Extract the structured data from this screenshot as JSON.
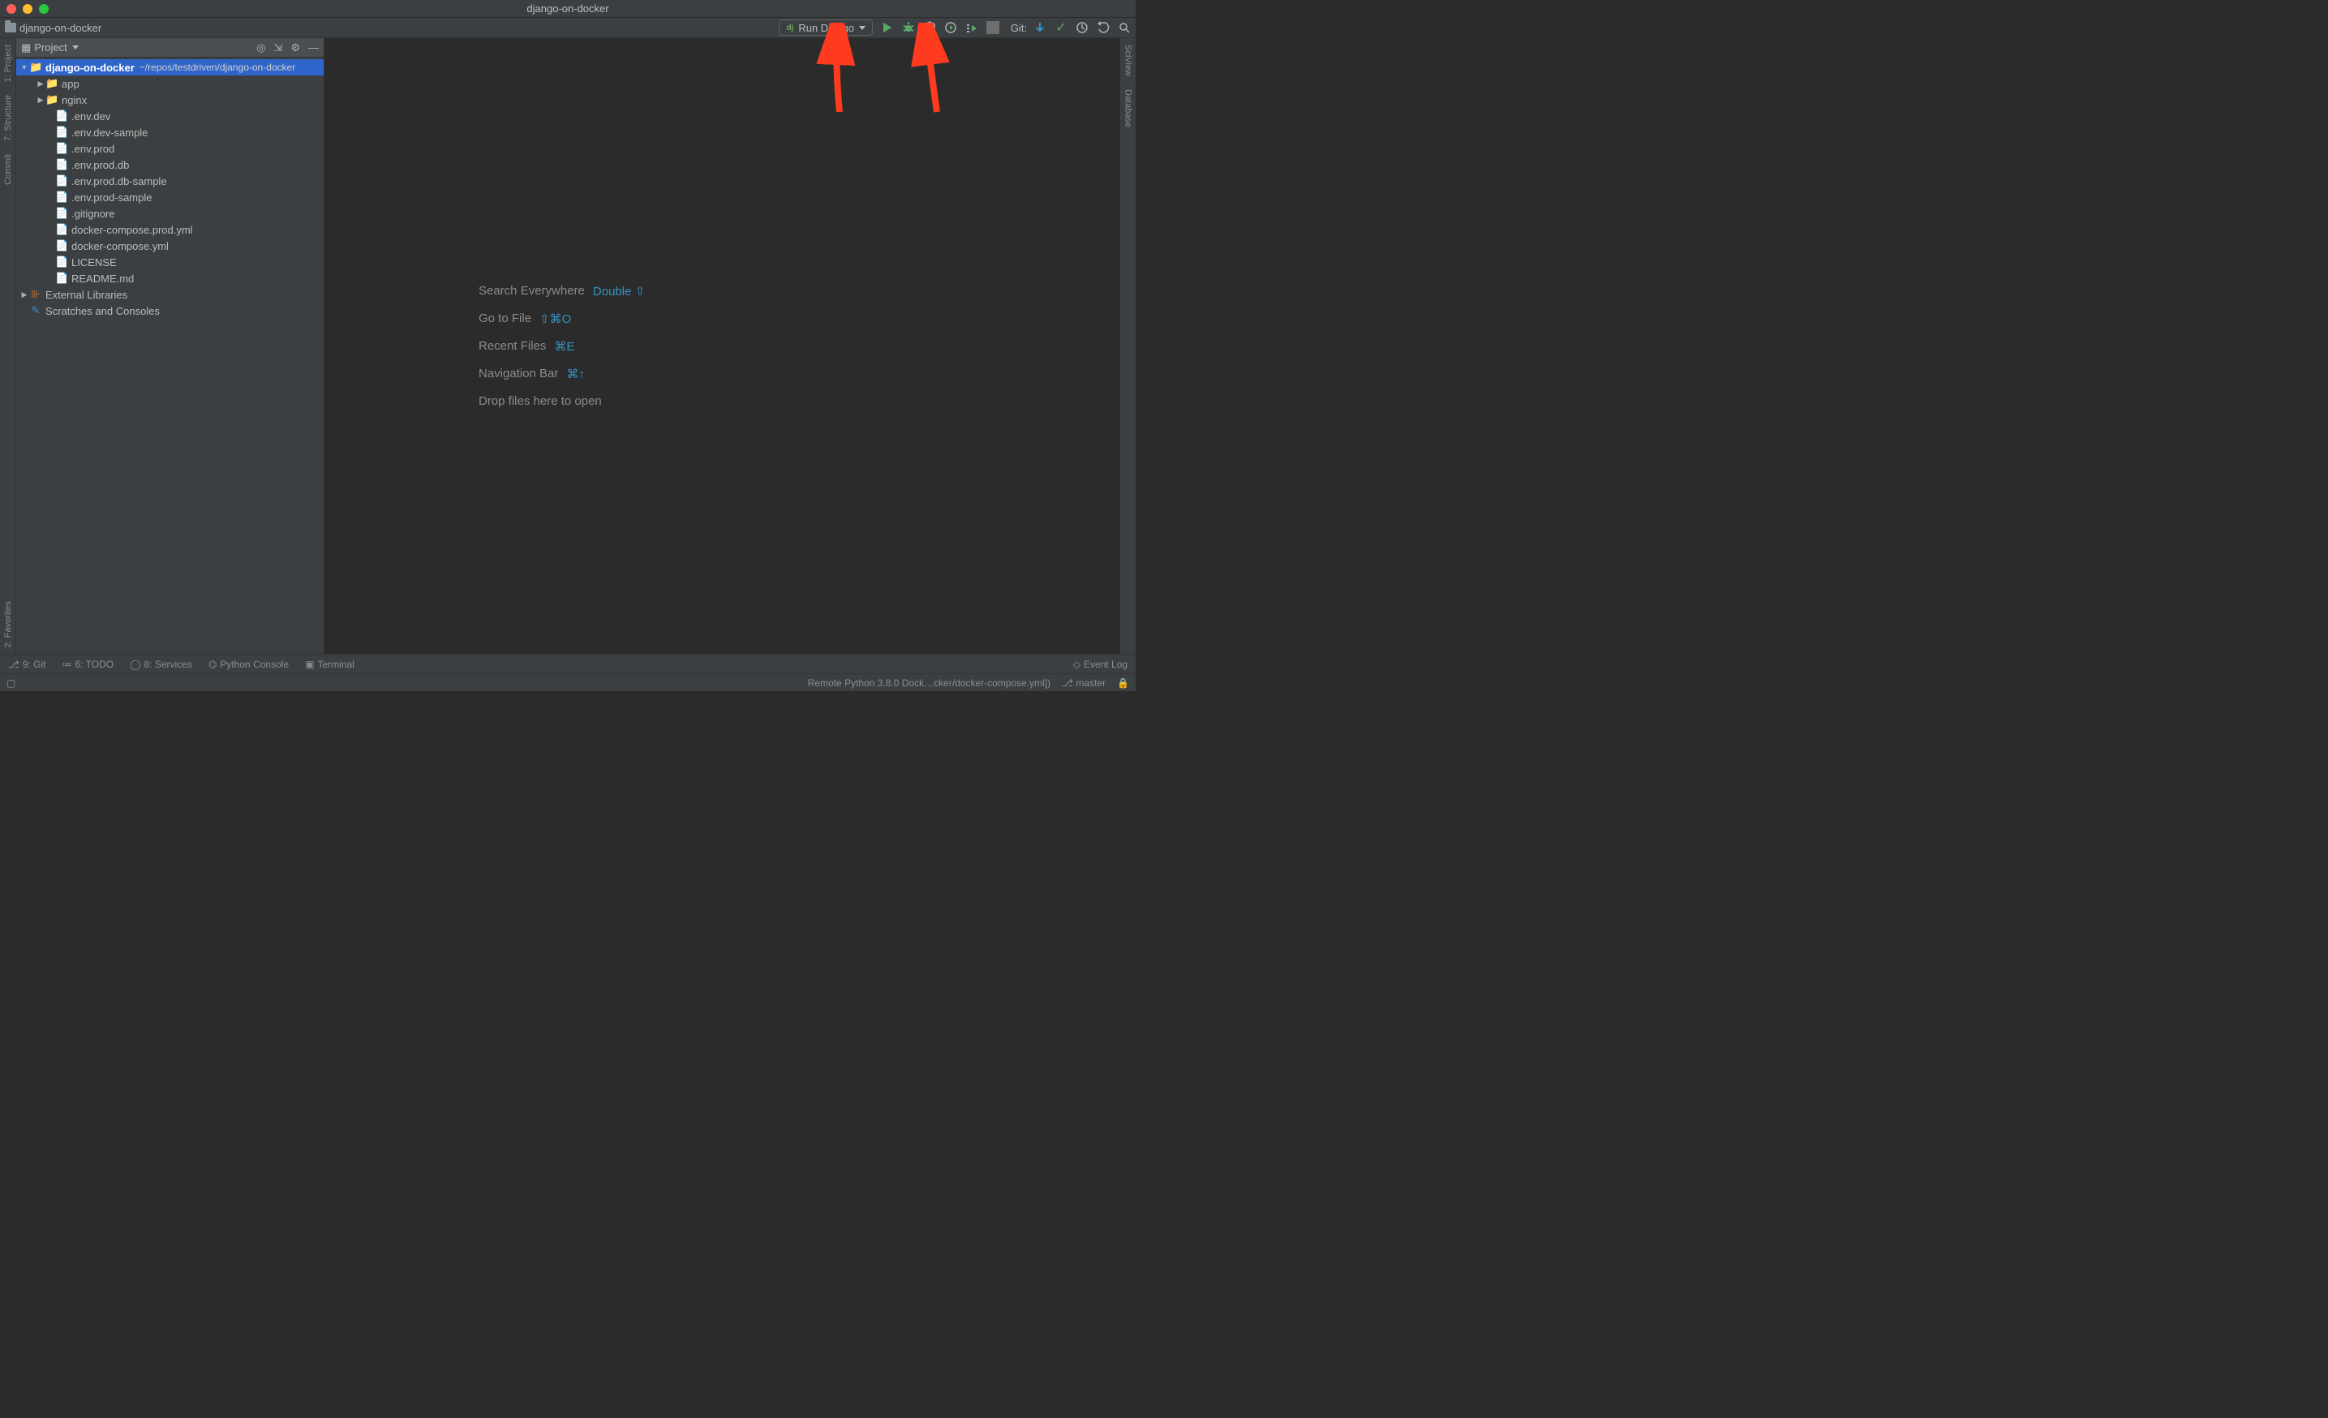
{
  "window": {
    "title": "django-on-docker"
  },
  "breadcrumb": {
    "root": "django-on-docker"
  },
  "runconfig": {
    "label": "Run Django"
  },
  "toolbar": {
    "git_label": "Git:"
  },
  "left_gutter": {
    "project": "1: Project",
    "structure": "7: Structure",
    "commit": "Commit",
    "favorites": "2: Favorites"
  },
  "right_gutter": {
    "sciview": "SciView",
    "database": "Database"
  },
  "project_tool": {
    "header": "Project",
    "tree": {
      "root": {
        "name": "django-on-docker",
        "path": "~/repos/testdriven/django-on-docker"
      },
      "folders": [
        {
          "name": "app"
        },
        {
          "name": "nginx"
        }
      ],
      "files": [
        {
          "name": ".env.dev",
          "cls": "c-olive"
        },
        {
          "name": ".env.dev-sample",
          "cls": "c-dim"
        },
        {
          "name": ".env.prod",
          "cls": "c-olive"
        },
        {
          "name": ".env.prod.db",
          "cls": "c-olive"
        },
        {
          "name": ".env.prod.db-sample",
          "cls": "c-dim"
        },
        {
          "name": ".env.prod-sample",
          "cls": "c-dim"
        },
        {
          "name": ".gitignore",
          "cls": "c-dim"
        },
        {
          "name": "docker-compose.prod.yml",
          "cls": "c-dim"
        },
        {
          "name": "docker-compose.yml",
          "cls": "c-blue"
        },
        {
          "name": "LICENSE",
          "cls": "c-dim"
        },
        {
          "name": "README.md",
          "cls": "c-dim"
        }
      ],
      "extlib": "External Libraries",
      "scratches": "Scratches and Consoles"
    }
  },
  "hints": [
    {
      "label": "Search Everywhere",
      "shortcut": "Double ⇧"
    },
    {
      "label": "Go to File",
      "shortcut": "⇧⌘O"
    },
    {
      "label": "Recent Files",
      "shortcut": "⌘E"
    },
    {
      "label": "Navigation Bar",
      "shortcut": "⌘↑"
    },
    {
      "label": "Drop files here to open",
      "shortcut": ""
    }
  ],
  "bottom_tools": {
    "git": "9: Git",
    "todo": "6: TODO",
    "services": "8: Services",
    "pyconsole": "Python Console",
    "terminal": "Terminal",
    "eventlog": "Event Log"
  },
  "status": {
    "interpreter": "Remote Python 3.8.0 Dock…cker/docker-compose.yml])",
    "branch": "master"
  }
}
